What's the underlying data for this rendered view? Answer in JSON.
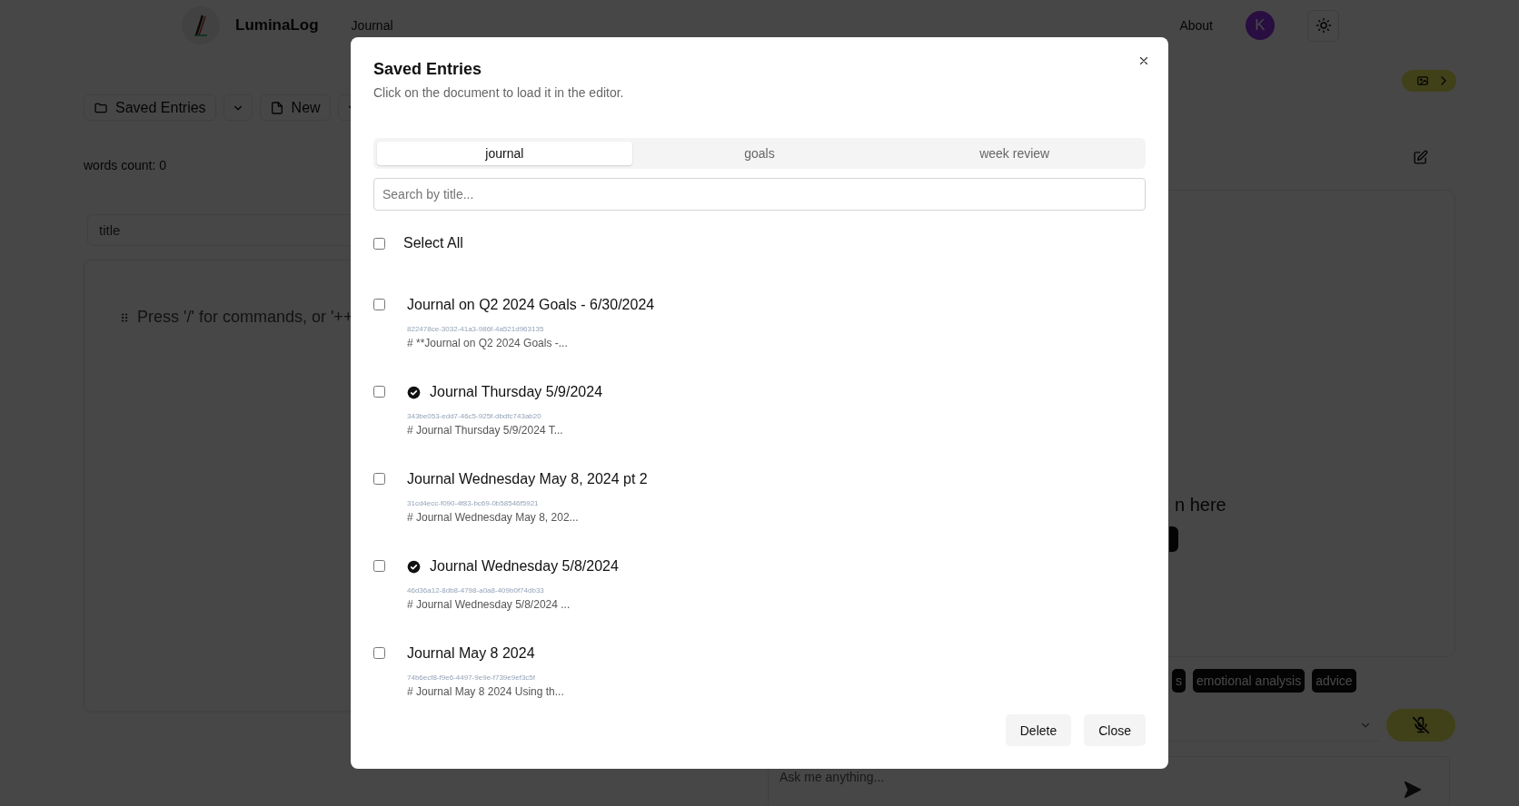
{
  "nav": {
    "brand": "LuminaLog",
    "links": [
      "Journal"
    ],
    "right_link": "About",
    "avatar": "K"
  },
  "toolbar": {
    "saved_button": "Saved Entries",
    "new_button": "New"
  },
  "editor": {
    "word_count": "words count: 0",
    "title_placeholder": "title",
    "body_placeholder": "Press '/' for commands, or '++"
  },
  "assistant": {
    "visible_text": "n here",
    "tags": [
      "s",
      "emotional analysis",
      "advice"
    ],
    "mic_muted": true,
    "ask_placeholder": "Ask me anything..."
  },
  "dialog": {
    "title": "Saved Entries",
    "subtitle": "Click on the document to load it in the editor.",
    "tabs": [
      {
        "label": "journal",
        "selected": true
      },
      {
        "label": "goals",
        "selected": false
      },
      {
        "label": "week review",
        "selected": false
      }
    ],
    "search_placeholder": "Search by title...",
    "select_all": {
      "label": "Select All",
      "checked": false
    },
    "entries": [
      {
        "title": "Journal on Q2 2024 Goals - 6/30/2024",
        "id": "822478ce-3032-41a3-986f-4a521d963135",
        "preview": "# **Journal on Q2 2024 Goals -...",
        "checked": false,
        "verified": false
      },
      {
        "title": "Journal Thursday 5/9/2024",
        "id": "343be053-edd7-46c5-925f-dbdfc743ab20",
        "preview": "# Journal Thursday 5/9/2024 T...",
        "checked": false,
        "verified": true
      },
      {
        "title": "Journal Wednesday May 8, 2024 pt 2",
        "id": "31cd4ecc-f090-4f83-bc69-0b58546f5921",
        "preview": "# Journal Wednesday May 8, 202...",
        "checked": false,
        "verified": false
      },
      {
        "title": "Journal Wednesday 5/8/2024",
        "id": "46d36a12-8db8-4798-a0a8-409b0f74db33",
        "preview": "# Journal Wednesday 5/8/2024 ...",
        "checked": false,
        "verified": true
      },
      {
        "title": "Journal May 8 2024",
        "id": "74b6ecf8-f9e6-4497-9e9e-f739e9ef3c5f",
        "preview": "# Journal May 8 2024 Using th...",
        "checked": false,
        "verified": false
      }
    ],
    "buttons": [
      "Delete",
      "Close"
    ]
  }
}
